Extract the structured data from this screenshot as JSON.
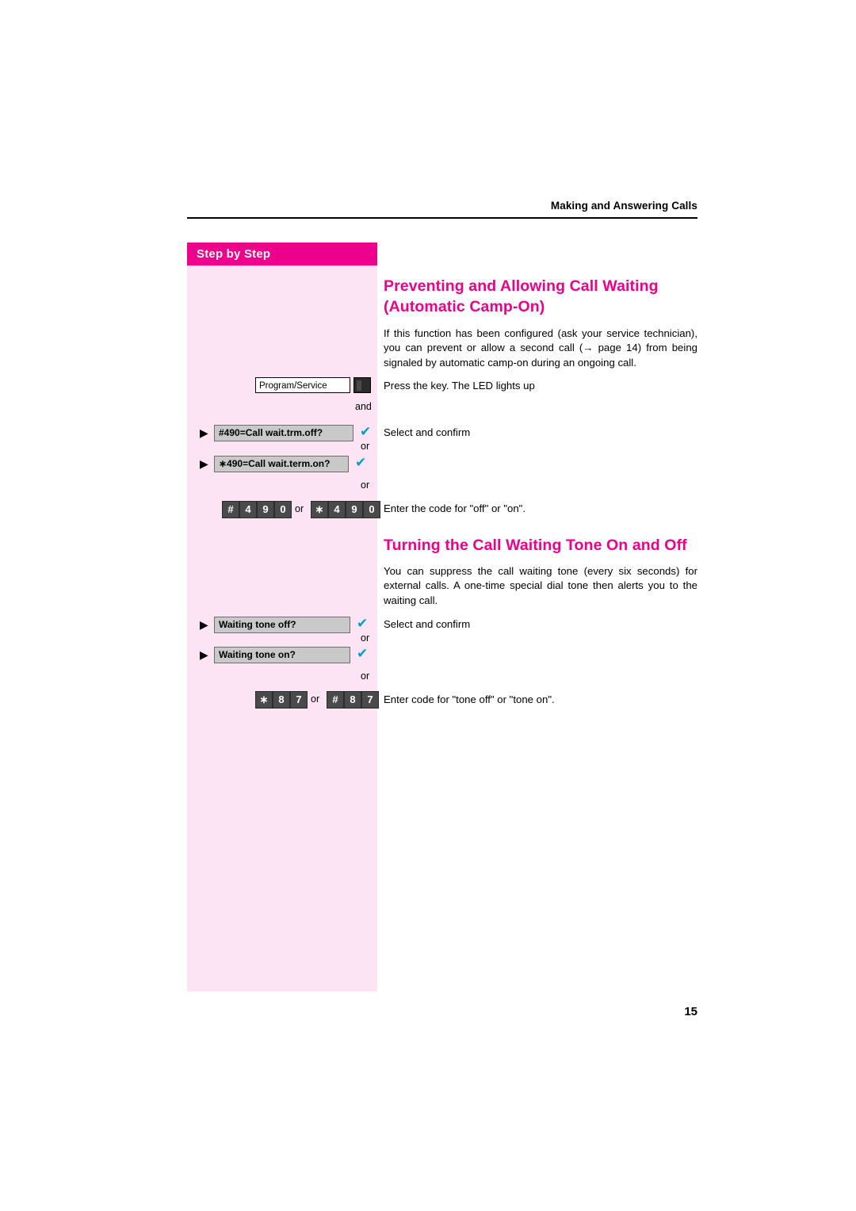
{
  "header": {
    "running_head": "Making and Answering Calls"
  },
  "sidebar": {
    "title": "Step by Step"
  },
  "sections": [
    {
      "heading_line1": "Preventing and Allowing Call Waiting",
      "heading_line2": "(Automatic Camp-On)",
      "body": "If this function has been configured (ask your service technician), you can prevent or allow a second call (→ page 14) from being signaled by automatic camp-on during an ongoing call."
    },
    {
      "heading": "Turning the Call Waiting Tone On and Off",
      "body": "You can suppress the call waiting tone (every six seconds) for external calls. A one-time special dial tone then alerts you to the waiting call."
    }
  ],
  "steps": {
    "program_key_label": "Program/Service",
    "press_key_text": "Press the key. The LED lights up",
    "and": "and",
    "or": "or",
    "select_confirm": "Select and confirm",
    "display_camp_off": "#490=Call wait.trm.off?",
    "display_camp_on": "∗490=Call wait.term.on?",
    "enter_code_text": "Enter the code for \"off\" or \"on\".",
    "display_tone_off": "Waiting tone off?",
    "display_tone_on": "Waiting tone on?",
    "enter_tone_code_text": "Enter code for \"tone off\" or \"tone on\".",
    "keys_camp": {
      "group1": [
        "#",
        "4",
        "9",
        "0"
      ],
      "separator": "or",
      "group2": [
        "∗",
        "4",
        "9",
        "0"
      ]
    },
    "keys_tone": {
      "group1": [
        "∗",
        "8",
        "7"
      ],
      "separator": "or",
      "group2": [
        "#",
        "8",
        "7"
      ]
    },
    "checkmark": "✔",
    "arrow": "▶"
  },
  "footer": {
    "page_number": "15"
  }
}
